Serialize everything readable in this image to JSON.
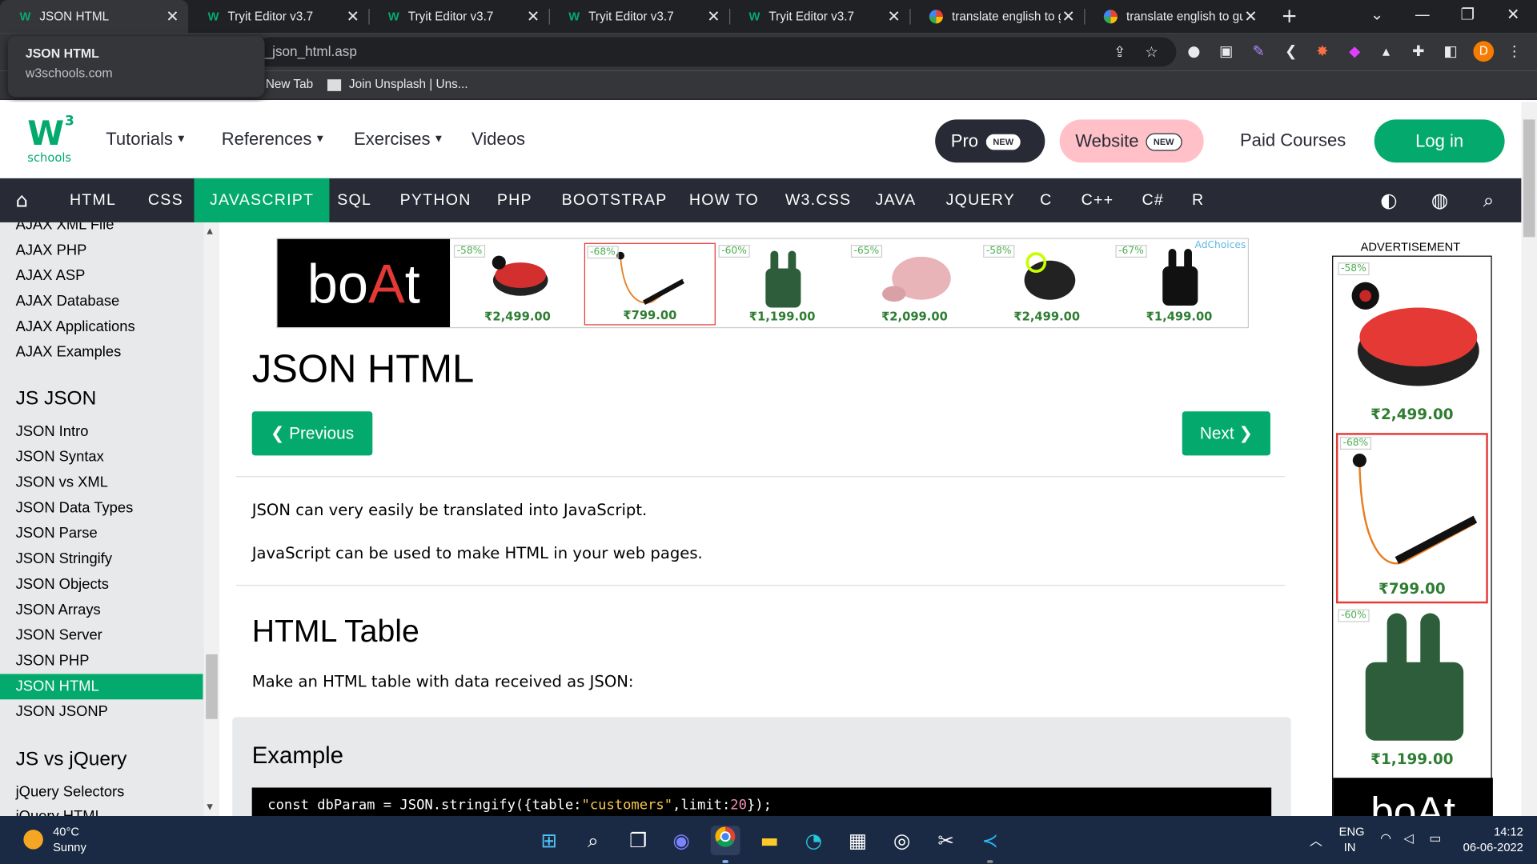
{
  "browser": {
    "tabs": [
      {
        "title": "JSON HTML",
        "favicon": "w3schools-icon"
      },
      {
        "title": "Tryit Editor v3.7",
        "favicon": "w3schools-icon"
      },
      {
        "title": "Tryit Editor v3.7",
        "favicon": "w3schools-icon"
      },
      {
        "title": "Tryit Editor v3.7",
        "favicon": "w3schools-icon"
      },
      {
        "title": "Tryit Editor v3.7",
        "favicon": "w3schools-icon"
      },
      {
        "title": "translate english to gu",
        "favicon": "google-icon"
      },
      {
        "title": "translate english to gu",
        "favicon": "google-icon"
      }
    ],
    "address": "_json_html.asp",
    "bookmarks": [
      "New Tab",
      "Join Unsplash | Uns..."
    ],
    "profile_initial": "D",
    "tooltip": {
      "title": "JSON HTML",
      "domain": "w3schools.com"
    }
  },
  "header": {
    "logo_sup": "3",
    "logo_text": "schools",
    "nav": [
      "Tutorials",
      "References",
      "Exercises",
      "Videos"
    ],
    "pro_label": "Pro",
    "new_badge": "NEW",
    "website_label": "Website",
    "paid_courses": "Paid Courses",
    "login": "Log in"
  },
  "topnav": {
    "items": [
      "HTML",
      "CSS",
      "JAVASCRIPT",
      "SQL",
      "PYTHON",
      "PHP",
      "BOOTSTRAP",
      "HOW TO",
      "W3.CSS",
      "JAVA",
      "JQUERY",
      "C",
      "C++",
      "C#",
      "R"
    ],
    "active": "JAVASCRIPT"
  },
  "sidebar": {
    "items": [
      "AJAX XML File",
      "AJAX PHP",
      "AJAX ASP",
      "AJAX Database",
      "AJAX Applications",
      "AJAX Examples"
    ],
    "json_heading": "JS JSON",
    "json_items": [
      "JSON Intro",
      "JSON Syntax",
      "JSON vs XML",
      "JSON Data Types",
      "JSON Parse",
      "JSON Stringify",
      "JSON Objects",
      "JSON Arrays",
      "JSON Server",
      "JSON PHP",
      "JSON HTML",
      "JSON JSONP"
    ],
    "jquery_heading": "JS vs jQuery",
    "jquery_items": [
      "jQuery Selectors",
      "jQuery HTML"
    ]
  },
  "ad_top": {
    "brand": "boAt",
    "adchoices": "AdChoices",
    "products": [
      {
        "discount": "-58%",
        "price": "₹2,499.00"
      },
      {
        "discount": "-68%",
        "price": "₹799.00"
      },
      {
        "discount": "-60%",
        "price": "₹1,199.00"
      },
      {
        "discount": "-65%",
        "price": "₹2,099.00"
      },
      {
        "discount": "-58%",
        "price": "₹2,499.00"
      },
      {
        "discount": "-67%",
        "price": "₹1,499.00"
      }
    ]
  },
  "content": {
    "title": "JSON HTML",
    "prev": "Previous",
    "next": "Next",
    "p1": "JSON can very easily be translated into JavaScript.",
    "p2": "JavaScript can be used to make HTML in your web pages.",
    "h2": "HTML Table",
    "p3": "Make an HTML table with data received as JSON:",
    "example_title": "Example",
    "code": {
      "kw": "const",
      "ident": " dbParam = JSON.stringify({table:",
      "str": "\"customers\"",
      "mid": ",limit:",
      "num": "20",
      "end": "});"
    }
  },
  "ad_right": {
    "label": "ADVERTISEMENT",
    "items": [
      {
        "discount": "-58%",
        "price": "₹2,499.00"
      },
      {
        "discount": "-68%",
        "price": "₹799.00"
      },
      {
        "discount": "-60%",
        "price": "₹1,199.00"
      }
    ],
    "brand": "boAt"
  },
  "taskbar": {
    "temp": "40°C",
    "weather": "Sunny",
    "lang1": "ENG",
    "lang2": "IN",
    "time": "14:12",
    "date": "06-06-2022"
  }
}
